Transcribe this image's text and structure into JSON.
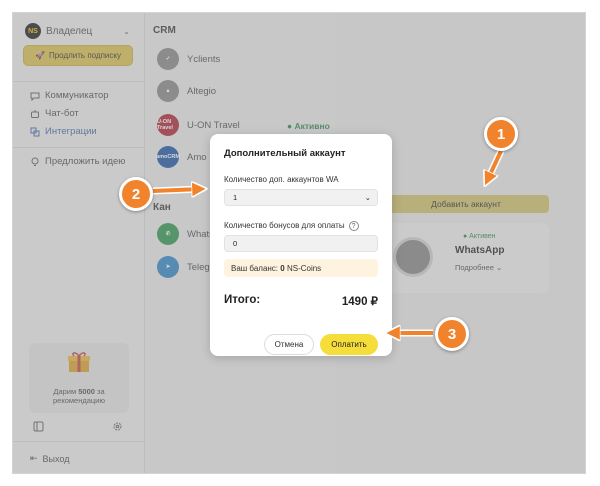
{
  "brand": {
    "logo_text": "NS",
    "name": "Владелец"
  },
  "sidebar": {
    "renew_label": "Продлить подписку",
    "items": [
      {
        "label": "Коммуникатор",
        "icon": "chat-bubble-icon"
      },
      {
        "label": "Чат-бот",
        "icon": "robot-icon"
      },
      {
        "label": "Интеграции",
        "icon": "integrations-icon",
        "active": true
      }
    ],
    "suggest_label": "Предложить идею",
    "promo_line1": "Дарим",
    "promo_amount": "5000",
    "promo_line2": "за рекомендацию",
    "logout_label": "Выход"
  },
  "middle": {
    "crm_heading": "CRM",
    "integrations": [
      {
        "name": "Yclients",
        "logo_color": "#8c8c8c"
      },
      {
        "name": "Altegio",
        "logo_color": "#8c8c8c"
      },
      {
        "name": "U-ON Travel",
        "logo_text": "U-ON Travel",
        "logo_color": "#b03040",
        "status": "● Активно"
      },
      {
        "name": "Amo",
        "logo_text": "amoCRM",
        "logo_color": "#2a5fa8"
      }
    ],
    "channels_heading": "Кан",
    "channels": [
      {
        "name": "Whats",
        "logo_color": "#3a9a5a"
      },
      {
        "name": "Teleg",
        "logo_color": "#3a8ac8"
      }
    ]
  },
  "right": {
    "add_account_label": "Добавить аккаунт",
    "account": {
      "status": "● Активен",
      "name": "WhatsApp",
      "more_label": "Подробнее"
    }
  },
  "modal": {
    "title": "Дополнительный аккаунт",
    "accounts_label": "Количество доп. аккаунтов WA",
    "accounts_value": "1",
    "bonus_label": "Количество бонусов для оплаты",
    "bonus_value": "0",
    "balance_prefix": "Ваш баланс:",
    "balance_amount": "0",
    "balance_currency": "NS-Coins",
    "total_label": "Итого:",
    "total_value": "1490 ₽",
    "cancel_label": "Отмена",
    "pay_label": "Оплатить"
  },
  "callouts": [
    {
      "number": "1"
    },
    {
      "number": "2"
    },
    {
      "number": "3"
    }
  ],
  "colors": {
    "accent_yellow": "#f5dd3a",
    "callout_orange": "#f0832b",
    "active_green": "#3a8b5a"
  }
}
